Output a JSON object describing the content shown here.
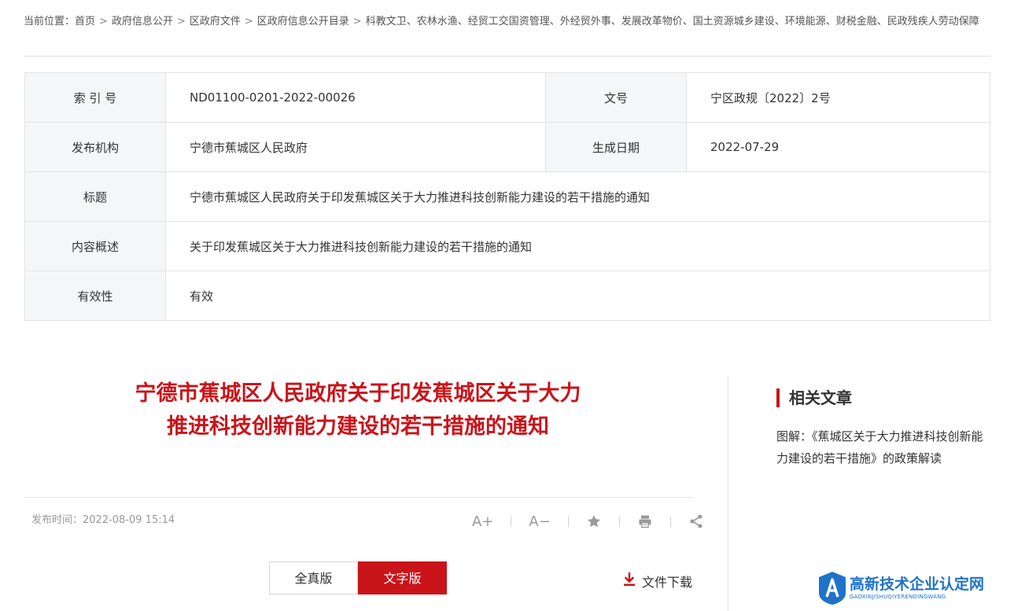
{
  "breadcrumb": {
    "prefix": "当前位置：",
    "items": [
      "首页",
      "政府信息公开",
      "区政府文件",
      "区政府信息公开目录",
      "科教文卫、农林水渔、经贸工交国资管理、外经贸外事、发展改革物价、国土资源城乡建设、环境能源、财税金融、民政残疾人劳动保障"
    ],
    "separator": ">"
  },
  "meta": {
    "index_label": "索 引 号",
    "index_value": "ND01100-0201-2022-00026",
    "docno_label": "文号",
    "docno_value": "宁区政规〔2022〕2号",
    "publisher_label": "发布机构",
    "publisher_value": "宁德市蕉城区人民政府",
    "date_label": "生成日期",
    "date_value": "2022-07-29",
    "title_label": "标题",
    "title_value": "宁德市蕉城区人民政府关于印发蕉城区关于大力推进科技创新能力建设的若干措施的通知",
    "summary_label": "内容概述",
    "summary_value": "关于印发蕉城区关于大力推进科技创新能力建设的若干措施的通知",
    "validity_label": "有效性",
    "validity_value": "有效"
  },
  "article": {
    "title": "宁德市蕉城区人民政府关于印发蕉城区关于大力推进科技创新能力建设的若干措施的通知",
    "publish_time": "发布时间：2022-08-09 15:14",
    "accent_color": "#c9141a"
  },
  "tools": {
    "font_increase": "A+",
    "font_decrease": "A−",
    "icons": [
      "star-icon",
      "print-icon",
      "share-icon"
    ]
  },
  "version_switch": {
    "full_label": "全真版",
    "text_label": "文字版",
    "selected": "文字版"
  },
  "download": {
    "label": "文件下载"
  },
  "related": {
    "heading": "相关文章",
    "items": [
      "图解：《蕉城区关于大力推进科技创新能力建设的若干措施》的政策解读"
    ]
  },
  "watermark": {
    "name": "高新技术企业认定网",
    "pinyin": "GAOXINJISHUQIYERENDINGWANG",
    "color": "#1e73c8"
  }
}
